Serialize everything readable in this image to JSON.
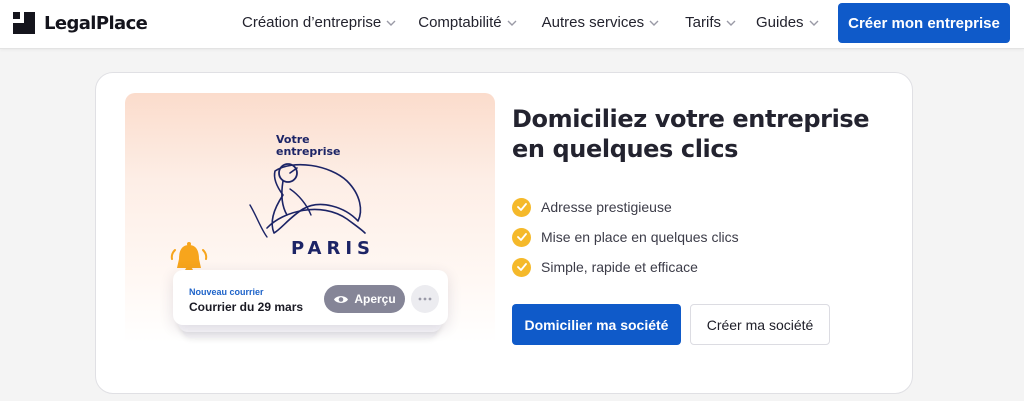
{
  "header": {
    "logo_text": "LegalPlace",
    "logo_icon": "legalplace-logo-icon",
    "nav": [
      {
        "label": "Création d’entreprise",
        "icon": "chevron-down-icon"
      },
      {
        "label": "Comptabilité",
        "icon": "chevron-down-icon"
      },
      {
        "label": "Autres services",
        "icon": "chevron-down-icon"
      },
      {
        "label": "Tarifs",
        "icon": "chevron-down-icon"
      },
      {
        "label": "Guides",
        "icon": "chevron-down-icon"
      }
    ],
    "cta_label": "Créer mon entreprise"
  },
  "hero": {
    "illustration": {
      "handwritten_label_line1": "Votre",
      "handwritten_label_line2": "entreprise",
      "city_label": "PARIS",
      "notification": {
        "tag": "Nouveau courrier",
        "title": "Courrier du 29 mars",
        "preview_button": "Aperçu",
        "more_icon": "more-dots-icon",
        "bell_icon": "bell-icon",
        "eye_icon": "eye-icon"
      }
    },
    "headline": "Domiciliez votre entreprise en quelques clics",
    "features": [
      {
        "label": "Adresse prestigieuse",
        "icon": "check-circle-icon"
      },
      {
        "label": "Mise en place en quelques clics",
        "icon": "check-circle-icon"
      },
      {
        "label": "Simple, rapide et efficace",
        "icon": "check-circle-icon"
      }
    ],
    "primary_button": "Domicilier ma société",
    "secondary_button": "Créer ma société"
  },
  "colors": {
    "brand_blue": "#0f5ac9",
    "check_yellow": "#f5b92a",
    "bell_orange": "#f7a51c",
    "ink_navy": "#1c2466"
  }
}
